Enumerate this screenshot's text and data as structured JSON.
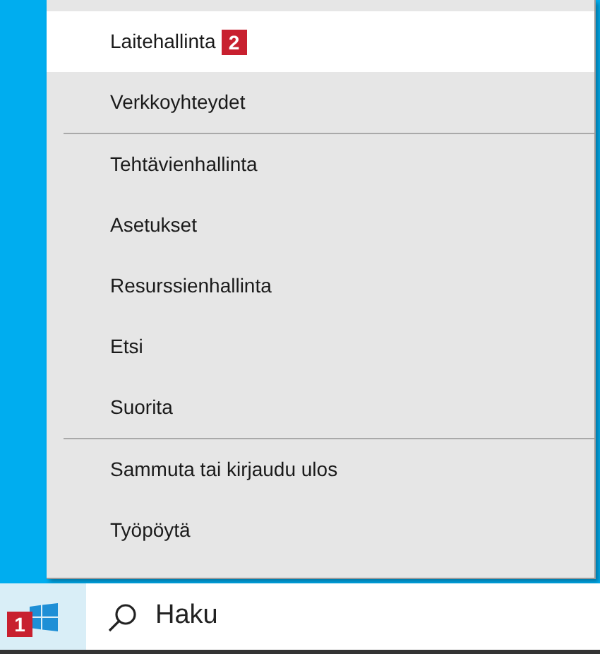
{
  "menu": {
    "groups": [
      {
        "items": [
          {
            "label": "Laitehallinta",
            "selected": true,
            "badge": "2"
          },
          {
            "label": "Verkkoyhteydet",
            "selected": false
          }
        ]
      },
      {
        "items": [
          {
            "label": "Tehtävienhallinta",
            "selected": false
          },
          {
            "label": "Asetukset",
            "selected": false
          },
          {
            "label": "Resurssienhallinta",
            "selected": false
          },
          {
            "label": "Etsi",
            "selected": false
          },
          {
            "label": "Suorita",
            "selected": false
          }
        ]
      },
      {
        "items": [
          {
            "label": "Sammuta tai kirjaudu ulos",
            "selected": false
          },
          {
            "label": "Työpöytä",
            "selected": false
          }
        ]
      }
    ]
  },
  "taskbar": {
    "start_badge": "1",
    "search": {
      "placeholder": "Haku"
    }
  }
}
